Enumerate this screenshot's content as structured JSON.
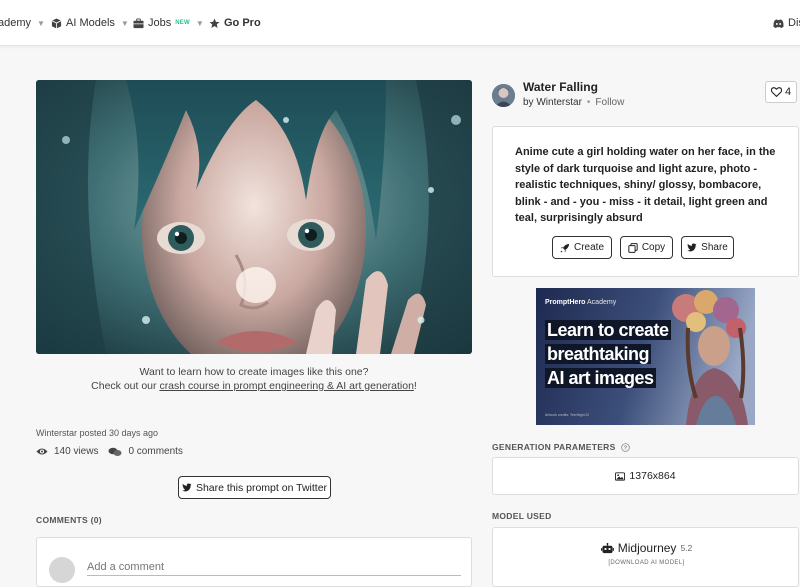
{
  "nav": {
    "items": [
      {
        "label": "ademy"
      },
      {
        "label": "AI Models"
      },
      {
        "label": "Jobs",
        "badge": "NEW"
      },
      {
        "label": "Go Pro"
      },
      {
        "label": "Dis"
      }
    ]
  },
  "image": {
    "title": "Water Falling",
    "by_prefix": "by",
    "author": "Winterstar",
    "follow_label": "Follow",
    "likes": "4"
  },
  "promo": {
    "line1": "Want to learn how to create images like this one?",
    "line2_prefix": "Check out our ",
    "link_text": "crash course in prompt engineering & AI art generation",
    "line2_suffix": "!"
  },
  "post": {
    "posted_text": "Winterstar posted 30 days ago",
    "views": "140 views",
    "comments": "0 comments",
    "share_twitter_label": "Share this prompt on Twitter"
  },
  "comments": {
    "heading": "COMMENTS (0)",
    "placeholder": "Add a comment"
  },
  "prompt": {
    "text": "Anime cute a girl holding water on her face, in the style of dark turquoise and light azure, photo - realistic techniques, shiny/ glossy, bombacore, blink - and - you - miss - it detail, light green and teal, surprisingly absurd",
    "create_label": "Create",
    "copy_label": "Copy",
    "share_label": "Share"
  },
  "ad": {
    "brand_bold": "PromptHero",
    "brand_rest": " Academy",
    "line1": "Learn to create",
    "line2": "breathtaking",
    "line3": "AI art images",
    "credit": "Artwork credits: TeerNiger12"
  },
  "generation": {
    "heading": "GENERATION PARAMETERS",
    "size": "1376x864"
  },
  "model": {
    "heading": "MODEL USED",
    "name": "Midjourney",
    "version": "5.2",
    "download_label": "[DOWNLOAD AI MODEL]"
  },
  "colors": {
    "accent_new": "#2bbf8a",
    "ad_bg": "#1f2a4a",
    "page_bg": "#f7f7f7"
  },
  "icons": [
    "graduation-icon",
    "cube-icon",
    "briefcase-icon",
    "star-icon",
    "discord-icon",
    "heart-icon",
    "eye-icon",
    "comments-icon",
    "twitter-icon",
    "rocket-icon",
    "copy-icon",
    "help-icon",
    "image-icon",
    "robot-icon"
  ]
}
